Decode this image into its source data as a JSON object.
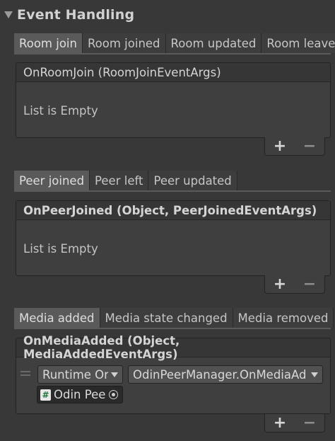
{
  "header": {
    "title": "Event Handling"
  },
  "room_section": {
    "tabs": [
      {
        "label": "Room join",
        "active": true
      },
      {
        "label": "Room joined",
        "active": false
      },
      {
        "label": "Room updated",
        "active": false
      },
      {
        "label": "Room leave",
        "active": false
      }
    ],
    "event_title": "OnRoomJoin (RoomJoinEventArgs)",
    "empty_text": "List is Empty",
    "add_label": "+",
    "remove_label": "−"
  },
  "peer_section": {
    "tabs": [
      {
        "label": "Peer joined",
        "active": true
      },
      {
        "label": "Peer left",
        "active": false
      },
      {
        "label": "Peer updated",
        "active": false
      }
    ],
    "event_title": "OnPeerJoined (Object, PeerJoinedEventArgs)",
    "empty_text": "List is Empty",
    "add_label": "+",
    "remove_label": "−"
  },
  "media_section": {
    "tabs": [
      {
        "label": "Media added",
        "active": true
      },
      {
        "label": "Media state changed",
        "active": false
      },
      {
        "label": "Media removed",
        "active": false
      }
    ],
    "event_title": "OnMediaAdded (Object, MediaAddedEventArgs)",
    "listener": {
      "runtime_option": "Runtime Or",
      "method": "OdinPeerManager.OnMediaAd",
      "target_object": "Odin Pee",
      "target_icon": "#"
    },
    "add_label": "+",
    "remove_label": "−"
  }
}
